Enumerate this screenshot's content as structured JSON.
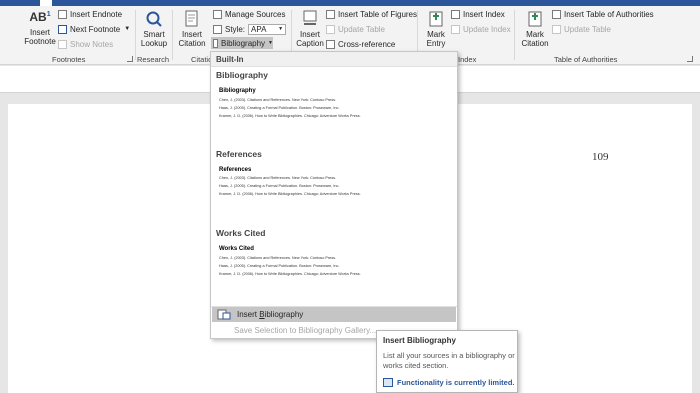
{
  "ribbon": {
    "footnotes": {
      "insert_footnote": "Insert\nFootnote",
      "insert_endnote": "Insert Endnote",
      "next_footnote": "Next Footnote",
      "show_notes": "Show Notes",
      "group_label": "Footnotes",
      "ab_icon_text": "AB"
    },
    "research": {
      "smart_lookup": "Smart\nLookup",
      "group_label": "Research"
    },
    "citations": {
      "insert_citation": "Insert\nCitation",
      "manage_sources": "Manage Sources",
      "style_label": "Style:",
      "style_value": "APA",
      "bibliography": "Bibliography",
      "group_label": "Citatio"
    },
    "captions": {
      "insert_caption": "Insert\nCaption",
      "insert_table_of_figures": "Insert Table of Figures",
      "update_table": "Update Table",
      "cross_reference": "Cross-reference"
    },
    "index": {
      "mark_entry": "Mark\nEntry",
      "insert_index": "Insert Index",
      "update_index": "Update Index",
      "group_label": "Index"
    },
    "toa": {
      "mark_citation": "Mark\nCitation",
      "insert_toa": "Insert Table of Authorities",
      "update_table": "Update Table",
      "group_label": "Table of Authorities"
    }
  },
  "document": {
    "page_number": "109"
  },
  "dropdown": {
    "header": "Built-In",
    "gallery": [
      {
        "title": "Bibliography",
        "preview_heading": "Bibliography",
        "lines": [
          "Chen, J. (2003). Citations and References. New York: Contoso Press.",
          "Haas, J. (2005). Creating a Formal Publication. Boston: Proseware, Inc.",
          "Kramer, J. D. (2006). How to Write Bibliographies. Chicago: Adventure Works Press."
        ]
      },
      {
        "title": "References",
        "preview_heading": "References",
        "lines": [
          "Chen, J. (2003). Citations and References. New York: Contoso Press.",
          "Haas, J. (2005). Creating a Formal Publication. Boston: Proseware, Inc.",
          "Kramer, J. D. (2006). How to Write Bibliographies. Chicago: Adventure Works Press."
        ]
      },
      {
        "title": "Works Cited",
        "preview_heading": "Works Cited",
        "lines": [
          "Chen, J. (2003). Citations and References. New York: Contoso Press.",
          "Haas, J. (2005). Creating a Formal Publication. Boston: Proseware, Inc.",
          "Kramer, J. D. (2006). How to Write Bibliographies. Chicago: Adventure Works Press."
        ]
      }
    ],
    "insert_bibliography_prefix": "Insert ",
    "insert_bibliography_underlined": "B",
    "insert_bibliography_suffix": "ibliography",
    "save_selection": "Save Selection to Bibliography Gallery..."
  },
  "tooltip": {
    "title": "Insert Bibliography",
    "description": "List all your sources in a bibliography or works cited section.",
    "warning": "Functionality is currently limited."
  },
  "colors": {
    "accent": "#2b579a",
    "highlight": "#c5c5c5"
  }
}
